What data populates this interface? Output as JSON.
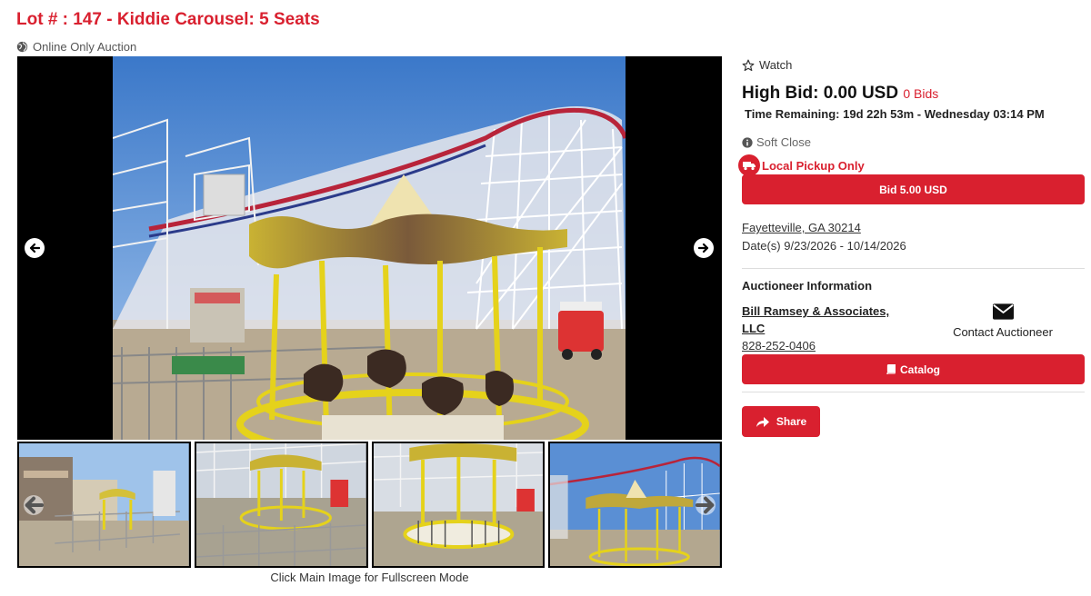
{
  "lot": {
    "title": "Lot # : 147 - Kiddie Carousel: 5 Seats",
    "auction_type": "Online Only Auction"
  },
  "gallery": {
    "caption": "Click Main Image for Fullscreen Mode",
    "thumbnail_count": 4,
    "selected_thumbnail": 4
  },
  "bidding": {
    "watch_label": "Watch",
    "high_bid_label": "High Bid: 0.00 USD",
    "bids_count": "0 Bids",
    "time_remaining": "Time Remaining: 19d 22h 53m - Wednesday 03:14 PM",
    "soft_close": "Soft Close",
    "pickup": "Local Pickup Only",
    "bid_button": "Bid 5.00 USD"
  },
  "location": {
    "address": "Fayetteville, GA 30214",
    "dates": "Date(s) 9/23/2026 - 10/14/2026"
  },
  "auctioneer": {
    "heading": "Auctioneer Information",
    "name": "Bill Ramsey & Associates, LLC",
    "phone": "828-252-0406",
    "contact_label": "Contact Auctioneer",
    "catalog_button": "Catalog"
  },
  "share_button": "Share",
  "colors": {
    "accent": "#d9202f",
    "viewer_bg": "#000000"
  },
  "icons": [
    "globe-icon",
    "arrow-left-icon",
    "arrow-right-icon",
    "star-icon",
    "info-icon",
    "truck-icon",
    "envelope-icon",
    "book-icon",
    "share-icon"
  ]
}
